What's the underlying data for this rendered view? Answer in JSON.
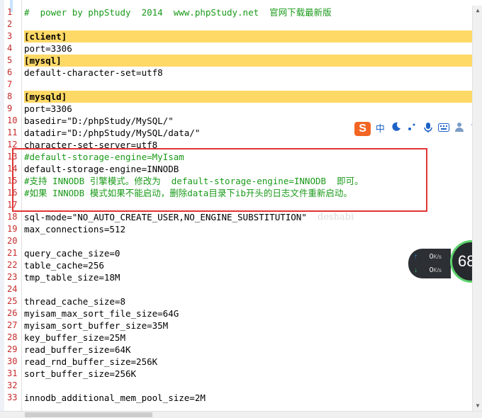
{
  "editor": {
    "lines": [
      {
        "num": "1",
        "text": "#  power by phpStudy  2014  www.phpStudy.net  官网下载最新版",
        "kind": "comment"
      },
      {
        "num": "2",
        "text": "",
        "kind": "blank"
      },
      {
        "num": "3",
        "text": "[client]",
        "kind": "section"
      },
      {
        "num": "4",
        "text": "port=3306",
        "kind": "kv"
      },
      {
        "num": "5",
        "text": "[mysql]",
        "kind": "section"
      },
      {
        "num": "6",
        "text": "default-character-set=utf8",
        "kind": "kv"
      },
      {
        "num": "7",
        "text": "",
        "kind": "blank"
      },
      {
        "num": "8",
        "text": "[mysqld]",
        "kind": "section"
      },
      {
        "num": "9",
        "text": "port=3306",
        "kind": "kv"
      },
      {
        "num": "10",
        "text": "basedir=\"D:/phpStudy/MySQL/\"",
        "kind": "kv"
      },
      {
        "num": "11",
        "text": "datadir=\"D:/phpStudy/MySQL/data/\"",
        "kind": "kv"
      },
      {
        "num": "12",
        "text": "character-set-server=utf8",
        "kind": "kv"
      },
      {
        "num": "13",
        "text": "#default-storage-engine=MyIsam",
        "kind": "comment"
      },
      {
        "num": "14",
        "text": "default-storage-engine=INNODB",
        "kind": "kv"
      },
      {
        "num": "15",
        "text": "#支持 INNODB 引擎模式。修改为  default-storage-engine=INNODB  即可。",
        "kind": "comment"
      },
      {
        "num": "16",
        "text": "#如果 INNODB 模式如果不能启动，删除data目录下ib开头的日志文件重新启动。",
        "kind": "comment"
      },
      {
        "num": "17",
        "text": "",
        "kind": "blank"
      },
      {
        "num": "18",
        "text": "sql-mode=\"NO_AUTO_CREATE_USER,NO_ENGINE_SUBSTITUTION\"",
        "kind": "kv"
      },
      {
        "num": "19",
        "text": "max_connections=512",
        "kind": "kv"
      },
      {
        "num": "20",
        "text": "",
        "kind": "blank"
      },
      {
        "num": "21",
        "text": "query_cache_size=0",
        "kind": "kv"
      },
      {
        "num": "22",
        "text": "table_cache=256",
        "kind": "kv"
      },
      {
        "num": "23",
        "text": "tmp_table_size=18M",
        "kind": "kv"
      },
      {
        "num": "24",
        "text": "",
        "kind": "blank"
      },
      {
        "num": "25",
        "text": "thread_cache_size=8",
        "kind": "kv"
      },
      {
        "num": "26",
        "text": "myisam_max_sort_file_size=64G",
        "kind": "kv"
      },
      {
        "num": "27",
        "text": "myisam_sort_buffer_size=35M",
        "kind": "kv"
      },
      {
        "num": "28",
        "text": "key_buffer_size=25M",
        "kind": "kv"
      },
      {
        "num": "29",
        "text": "read_buffer_size=64K",
        "kind": "kv"
      },
      {
        "num": "30",
        "text": "read_rnd_buffer_size=256K",
        "kind": "kv"
      },
      {
        "num": "31",
        "text": "sort_buffer_size=256K",
        "kind": "kv"
      },
      {
        "num": "32",
        "text": "",
        "kind": "blank"
      },
      {
        "num": "33",
        "text": "innodb_additional_mem_pool_size=2M",
        "kind": "kv"
      }
    ]
  },
  "left_edge_numbers": [
    "3",
    "3",
    "3",
    "3",
    "3",
    "3",
    "3",
    "3",
    "3",
    "3",
    "3",
    "3",
    "3",
    "3",
    "3",
    "3",
    "3",
    "3",
    "3",
    "3",
    "3",
    "3",
    "3",
    "3",
    "3",
    "3",
    "3",
    "3",
    "3",
    "3",
    "20",
    "21"
  ],
  "watermark": "deshabi",
  "ime_toolbar": {
    "logo": "S",
    "mode": "中",
    "items": [
      "moon-icon",
      "punctuation-icon",
      "microphone-icon",
      "keyboard-icon",
      "user-icon",
      "shirt-icon"
    ]
  },
  "net_monitor": {
    "upload": "0",
    "download": "0",
    "unit": "K/s",
    "percent": "68",
    "percent_unit": "%"
  },
  "colors": {
    "section_highlight": "#ffd966",
    "line_number": "#c62a2a",
    "comment": "#1a9a1a",
    "annotation_box": "#e23434"
  }
}
